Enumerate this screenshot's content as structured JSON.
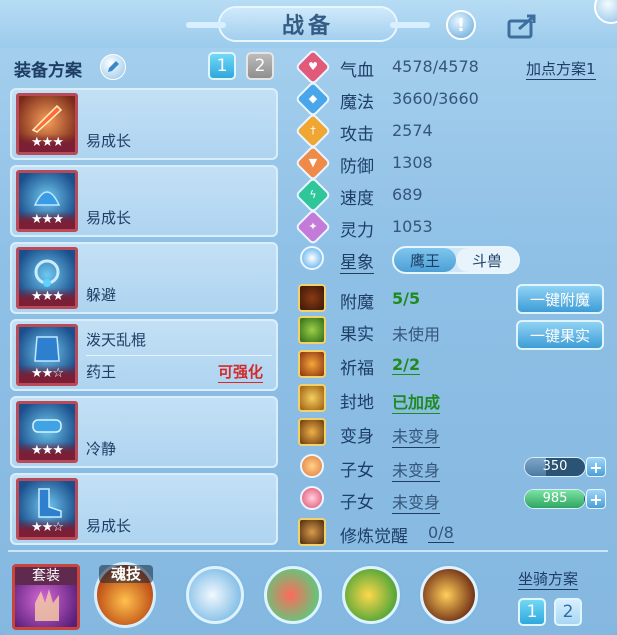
{
  "header": {
    "title": "战备",
    "help_symbol": "!"
  },
  "left": {
    "scheme_label": "装备方案",
    "scheme_buttons": [
      "1",
      "2"
    ],
    "equipment": [
      {
        "name": "易成长",
        "subname": "",
        "stars": "★★★",
        "tag": ""
      },
      {
        "name": "易成长",
        "subname": "",
        "stars": "★★★",
        "tag": ""
      },
      {
        "name": "躲避",
        "subname": "",
        "stars": "★★★",
        "tag": ""
      },
      {
        "name": "泼天乱棍",
        "subname": "药王",
        "stars": "★★☆",
        "tag": "可强化"
      },
      {
        "name": "冷静",
        "subname": "",
        "stars": "★★★",
        "tag": ""
      },
      {
        "name": "易成长",
        "subname": "",
        "stars": "★★☆",
        "tag": ""
      }
    ]
  },
  "stats": {
    "add_point_label": "加点方案1",
    "items": [
      {
        "label": "气血",
        "value": "4578/4578",
        "icon": "heart-icon",
        "color": "#e25a7a"
      },
      {
        "label": "魔法",
        "value": "3660/3660",
        "icon": "mana-icon",
        "color": "#4aa6ea"
      },
      {
        "label": "攻击",
        "value": "2574",
        "icon": "sword-icon",
        "color": "#f0a632"
      },
      {
        "label": "防御",
        "value": "1308",
        "icon": "shield-icon",
        "color": "#f08a4a"
      },
      {
        "label": "速度",
        "value": "689",
        "icon": "speed-icon",
        "color": "#2fc79a"
      },
      {
        "label": "灵力",
        "value": "1053",
        "icon": "spirit-icon",
        "color": "#c47ad8"
      }
    ],
    "star": {
      "label": "星象",
      "options": [
        "鹰王",
        "斗兽"
      ],
      "selected": "鹰王"
    }
  },
  "extras": {
    "enchant": {
      "label": "附魔",
      "value": "5/5",
      "button": "一键附魔"
    },
    "fruit": {
      "label": "果实",
      "value": "未使用",
      "button": "一键果实"
    },
    "bless": {
      "label": "祈福",
      "value": "2/2"
    },
    "seal": {
      "label": "封地",
      "value": "已加成"
    },
    "transform": {
      "label": "变身",
      "value": "未变身"
    },
    "child1": {
      "label": "子女",
      "value": "未变身",
      "bar_value": "350",
      "bar_fraction": 0.35
    },
    "child2": {
      "label": "子女",
      "value": "未变身",
      "bar_value": "985",
      "bar_fraction": 0.985
    },
    "cultivation": {
      "label": "修炼觉醒",
      "value": "0/8"
    }
  },
  "bottom": {
    "set_label": "套装",
    "soul_label": "魂技",
    "mount_label": "坐骑方案",
    "mount_buttons": [
      "1",
      "2"
    ]
  },
  "colors": {
    "accent": "#2ea8dd",
    "warning": "#d22b2b",
    "success": "#1f8a1f"
  }
}
